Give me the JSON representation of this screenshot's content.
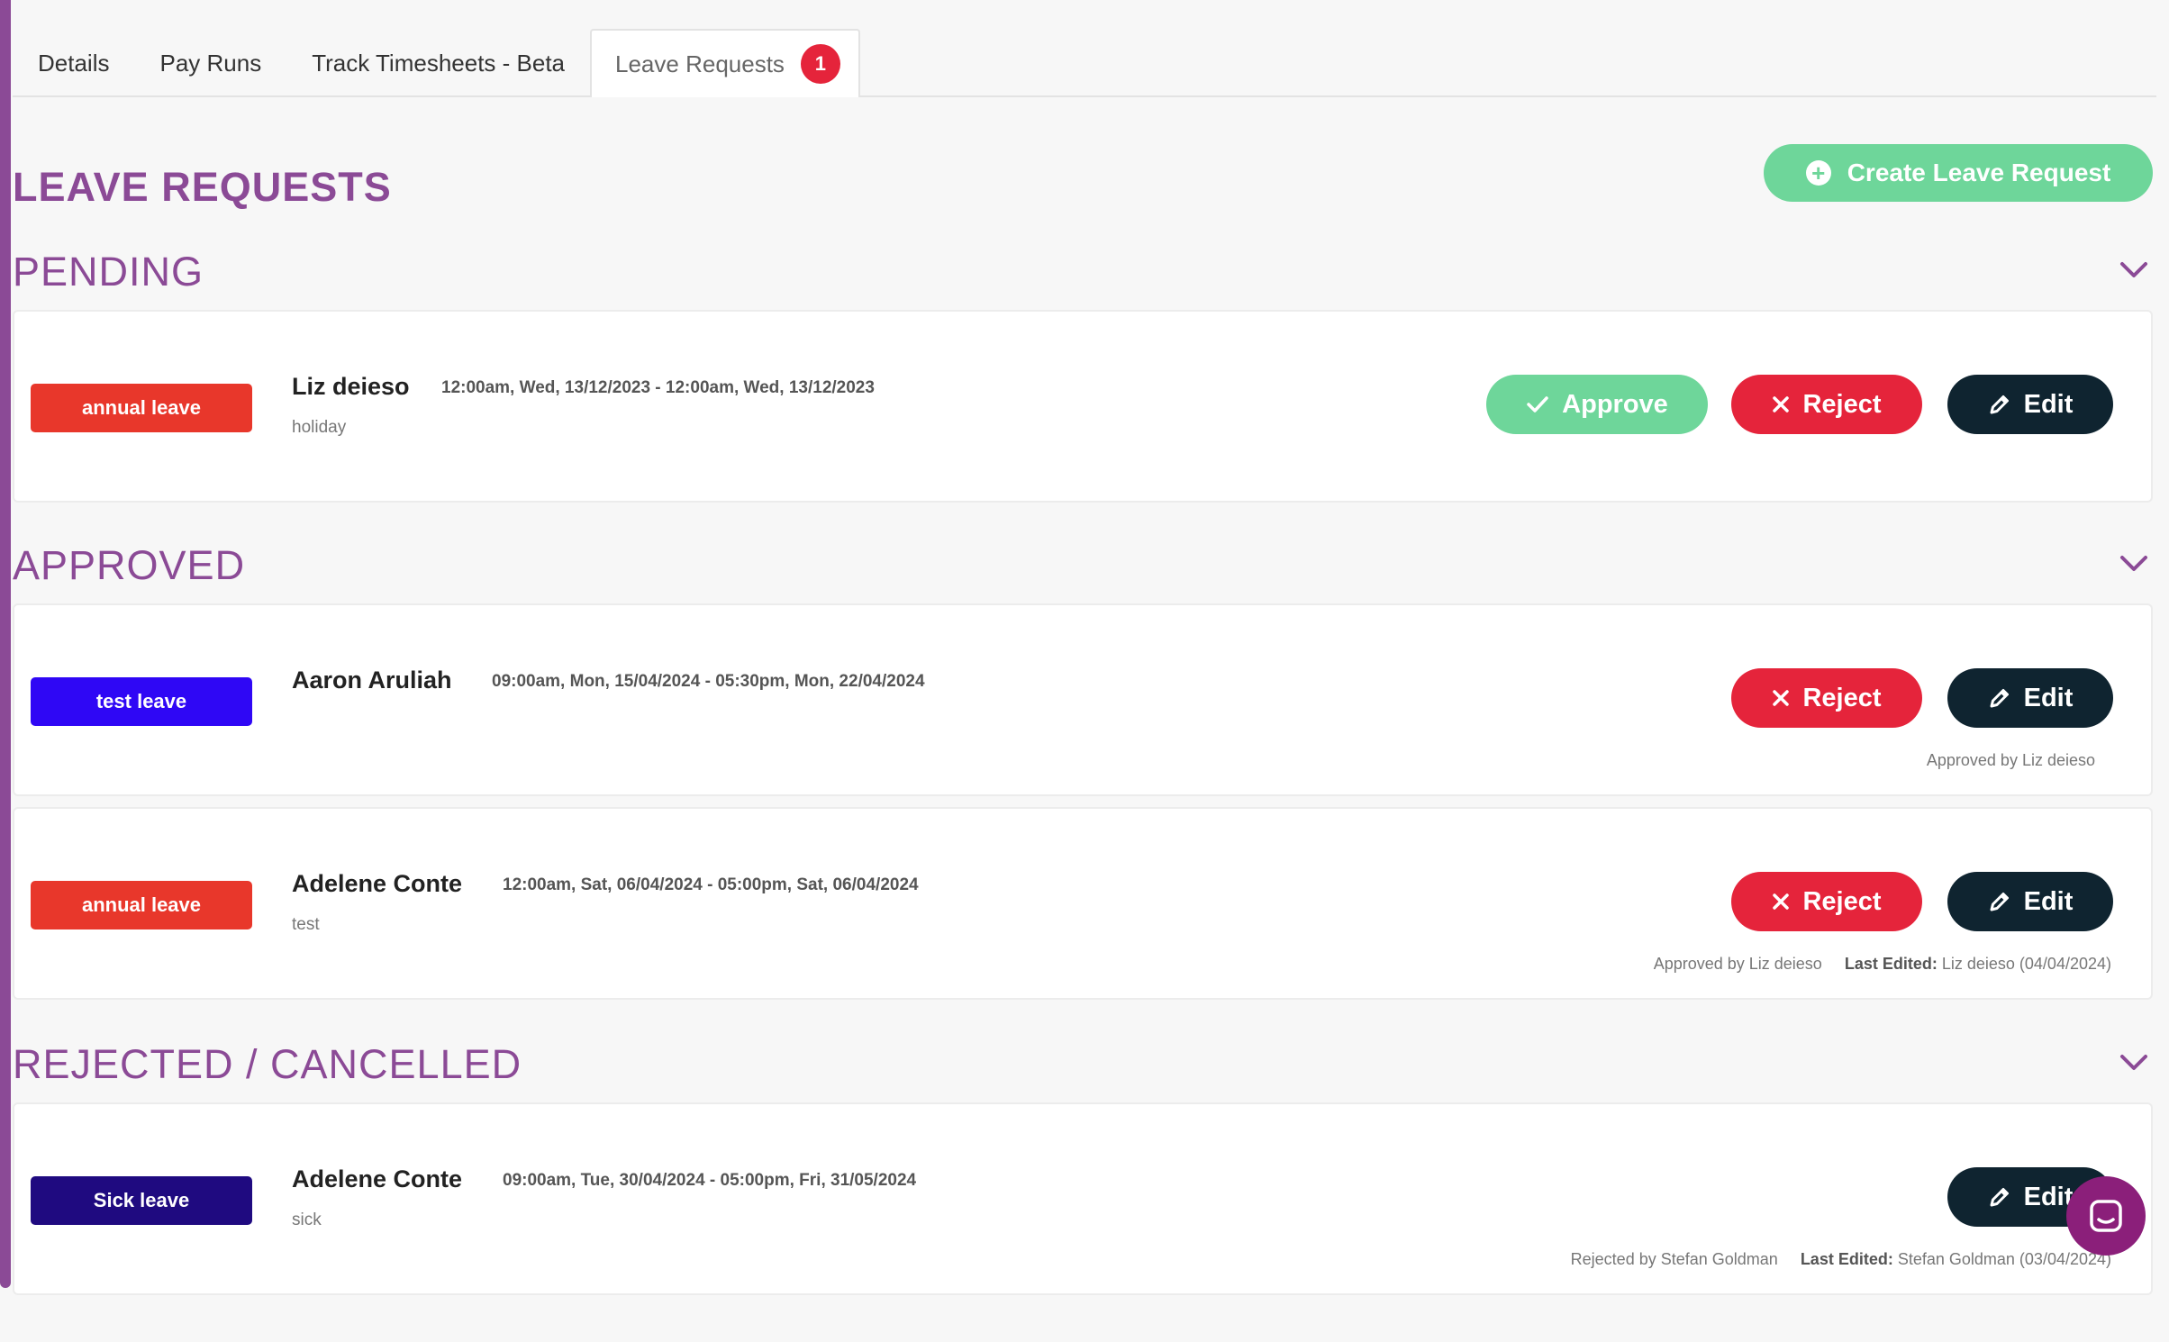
{
  "tabs": [
    {
      "label": "Details"
    },
    {
      "label": "Pay Runs"
    },
    {
      "label": "Track Timesheets - Beta"
    },
    {
      "label": "Leave Requests",
      "badge": "1",
      "active": true
    }
  ],
  "page": {
    "title": "LEAVE REQUESTS",
    "create_button": "Create Leave Request"
  },
  "sections": {
    "pending": {
      "title": "PENDING",
      "items": [
        {
          "tag": "annual leave",
          "tag_color": "#e8372b",
          "name": "Liz deieso",
          "dates": "12:00am, Wed, 13/12/2023 - 12:00am, Wed, 13/12/2023",
          "note": "holiday",
          "approve_label": "Approve",
          "reject_label": "Reject",
          "edit_label": "Edit"
        }
      ]
    },
    "approved": {
      "title": "APPROVED",
      "items": [
        {
          "tag": "test leave",
          "tag_color": "#2f07f5",
          "name": "Aaron Aruliah",
          "dates": "09:00am, Mon, 15/04/2024 - 05:30pm, Mon, 22/04/2024",
          "note": "",
          "reject_label": "Reject",
          "edit_label": "Edit",
          "status_by": "Approved by Liz deieso"
        },
        {
          "tag": "annual leave",
          "tag_color": "#e8372b",
          "name": "Adelene Conte",
          "dates": "12:00am, Sat, 06/04/2024 - 05:00pm, Sat, 06/04/2024",
          "note": "test",
          "reject_label": "Reject",
          "edit_label": "Edit",
          "status_by": "Approved by Liz deieso",
          "last_edited_label": "Last Edited:",
          "last_edited_value": "Liz deieso (04/04/2024)"
        }
      ]
    },
    "rejected": {
      "title": "REJECTED / CANCELLED",
      "items": [
        {
          "tag": "Sick leave",
          "tag_color": "#1f0a80",
          "name": "Adelene Conte",
          "dates": "09:00am, Tue, 30/04/2024 - 05:00pm, Fri, 31/05/2024",
          "note": "sick",
          "edit_label": "Edit",
          "status_by": "Rejected by Stefan Goldman",
          "last_edited_label": "Last Edited:",
          "last_edited_value": "Stefan Goldman (03/04/2024)"
        }
      ]
    }
  },
  "colors": {
    "brand_purple": "#8b4a96",
    "approve_green": "#6ed69a",
    "reject_red": "#e5243b",
    "edit_dark": "#0f2430",
    "chat_purple": "#8b1f7a"
  },
  "icons": [
    "plus-circle-icon",
    "chevron-down-icon",
    "check-icon",
    "close-icon",
    "pencil-icon",
    "chat-icon"
  ]
}
